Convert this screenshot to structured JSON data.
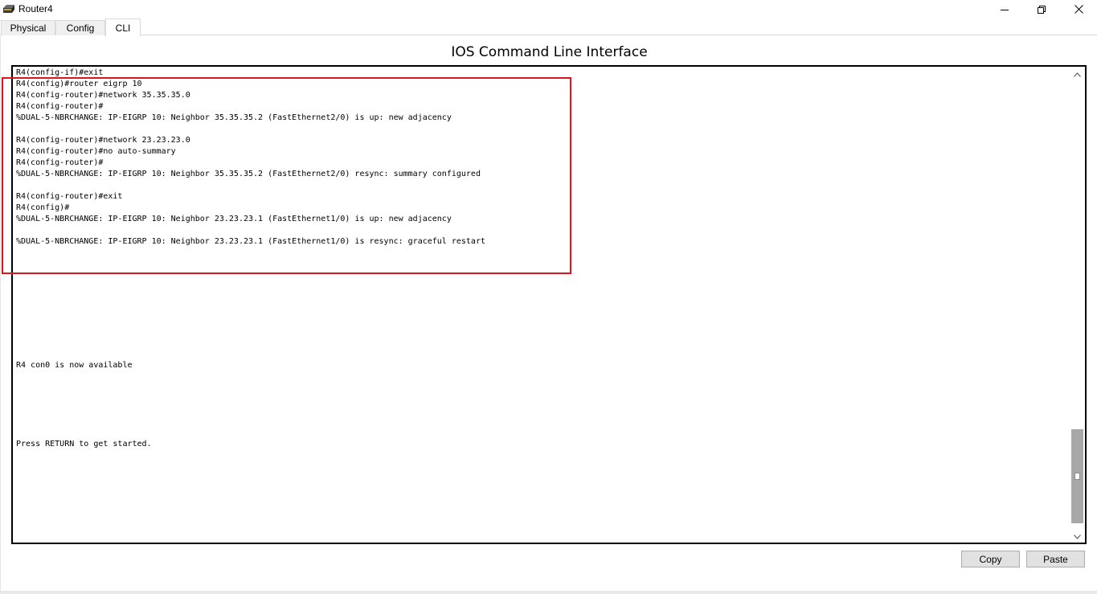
{
  "window": {
    "title": "Router4"
  },
  "tabs": [
    {
      "label": "Physical"
    },
    {
      "label": "Config"
    },
    {
      "label": "CLI"
    }
  ],
  "cli": {
    "heading": "IOS Command Line Interface",
    "lines": [
      "R4(config-if)#exit",
      "R4(config)#router eigrp 10",
      "R4(config-router)#network 35.35.35.0",
      "R4(config-router)#",
      "%DUAL-5-NBRCHANGE: IP-EIGRP 10: Neighbor 35.35.35.2 (FastEthernet2/0) is up: new adjacency",
      "",
      "R4(config-router)#network 23.23.23.0",
      "R4(config-router)#no auto-summary",
      "R4(config-router)#",
      "%DUAL-5-NBRCHANGE: IP-EIGRP 10: Neighbor 35.35.35.2 (FastEthernet2/0) resync: summary configured",
      "",
      "R4(config-router)#exit",
      "R4(config)#",
      "%DUAL-5-NBRCHANGE: IP-EIGRP 10: Neighbor 23.23.23.1 (FastEthernet1/0) is up: new adjacency",
      "",
      "%DUAL-5-NBRCHANGE: IP-EIGRP 10: Neighbor 23.23.23.1 (FastEthernet1/0) is resync: graceful restart",
      "",
      "",
      "",
      "",
      "",
      "",
      "",
      "",
      "",
      "",
      "R4 con0 is now available",
      "",
      "",
      "",
      "",
      "",
      "",
      "Press RETURN to get started."
    ]
  },
  "buttons": {
    "copy": "Copy",
    "paste": "Paste"
  },
  "icons": {
    "app": "router-icon",
    "minimize": "minimize-icon",
    "maximize": "restore-icon",
    "close": "close-icon"
  },
  "colors": {
    "highlight": "#e0141e"
  }
}
